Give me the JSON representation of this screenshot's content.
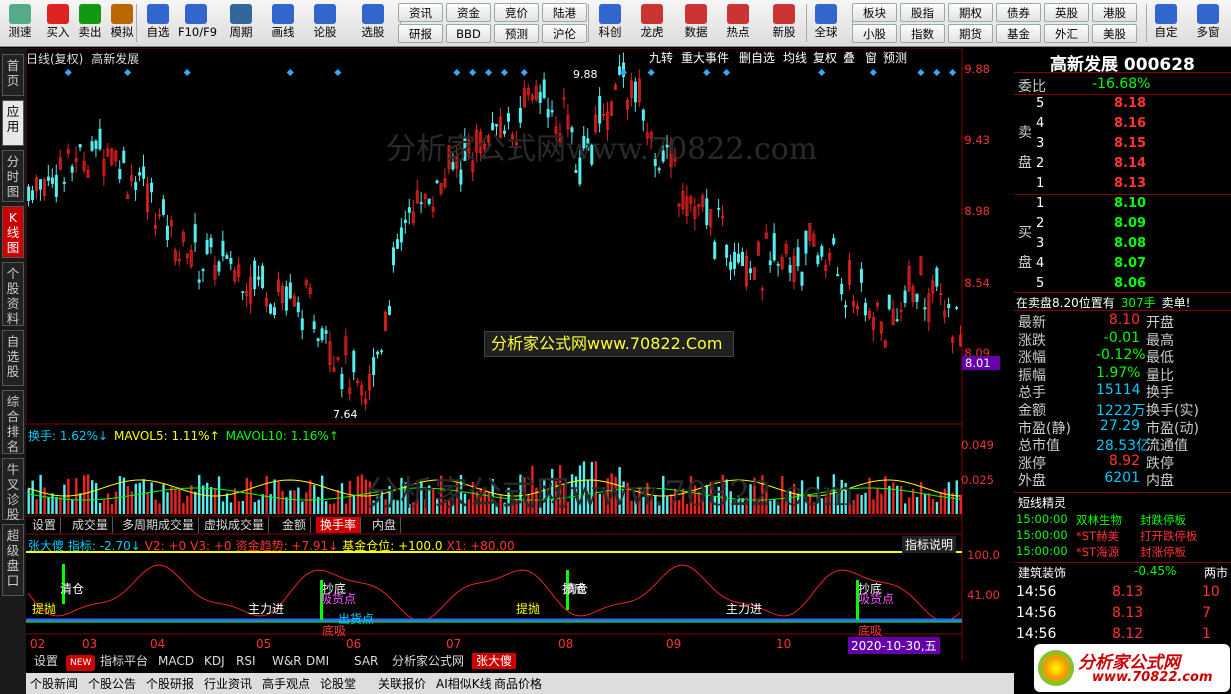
{
  "toolbar": {
    "items": [
      {
        "label": "测速",
        "color": "#5a8"
      },
      {
        "label": "买入",
        "color": "#d22"
      },
      {
        "label": "卖出",
        "color": "#191"
      },
      {
        "label": "模拟",
        "color": "#b60"
      },
      {
        "label": "自选",
        "color": "#36c"
      },
      {
        "label": "F10/F9",
        "color": "#36c"
      },
      {
        "label": "周期",
        "color": "#369"
      },
      {
        "label": "画线",
        "color": "#36c"
      },
      {
        "label": "论股",
        "color": "#36c"
      },
      {
        "label": "选股",
        "color": "#36c"
      },
      {
        "label": "科创",
        "color": "#36c"
      },
      {
        "label": "龙虎",
        "color": "#c33"
      },
      {
        "label": "数据",
        "color": "#c33"
      },
      {
        "label": "热点",
        "color": "#c33"
      },
      {
        "label": "新股",
        "color": "#c33"
      },
      {
        "label": "全球",
        "color": "#36c"
      },
      {
        "label": "自定",
        "color": "#36c"
      },
      {
        "label": "多窗",
        "color": "#36c"
      }
    ],
    "menu_row1": [
      "资讯",
      "资金",
      "竞价",
      "陆港",
      "板块",
      "股指",
      "期权",
      "债券",
      "英股",
      "港股"
    ],
    "menu_row2": [
      "研报",
      "BBD",
      "预测",
      "沪伦",
      "小股",
      "指数",
      "期货",
      "基金",
      "外汇",
      "美股"
    ]
  },
  "left_tabs": [
    "首页",
    "应用",
    "分时图",
    "K线图",
    "个股资料",
    "自选股",
    "综合排名",
    "牛叉诊股",
    "超级盘口"
  ],
  "chart": {
    "header": "日线(复权)",
    "name": "高新发展",
    "buttons": [
      "九转",
      "重大事件",
      "删自选",
      "均线",
      "复权",
      "叠",
      "窗",
      "预测"
    ],
    "price_labels": [
      "9.88",
      "9.43",
      "8.98",
      "8.54",
      "8.09"
    ],
    "current_price": "8.01",
    "high_label": "9.88",
    "low_label": "7.64",
    "watermark": "分析家公式网www.70822.com",
    "watermark_box": "分析家公式网www.70822.Com",
    "vol_info": {
      "a": "换手: 1.62%↓",
      "b": "MAVOL5: 1.11%↑",
      "c": "MAVOL10: 1.16%↑"
    },
    "vol_labels": [
      "0.049",
      "0.025"
    ],
    "sub_tabs": [
      "设置",
      "成交量",
      "多周期成交量",
      "虚拟成交量",
      "金额",
      "换手率",
      "内盘"
    ],
    "ind_info": {
      "a": "张大傻 指标: -2.70↓",
      "b": "V2: +0",
      "c": "V3: +0",
      "d": "资金趋势: +7.91↓",
      "e": "基金仓位: +100.0",
      "f": "X1: +80.00"
    },
    "ind_help": "指标说明",
    "ind_labels": [
      "100.0",
      "41.00"
    ],
    "signals": [
      "清仓",
      "抄底",
      "主力进",
      "提抛",
      "吸货点",
      "出货点",
      "底吸",
      "抄底",
      "主力进",
      "清仓",
      "抄底",
      "提抛",
      "吸货点",
      "底吸"
    ],
    "months": [
      "02",
      "03",
      "04",
      "05",
      "06",
      "07",
      "08",
      "09",
      "10"
    ],
    "date_label": "2020-10-30,五"
  },
  "bottom": {
    "tabs1": [
      "设置",
      "NEW",
      "指标平台",
      "MACD",
      "KDJ",
      "RSI",
      "W&R",
      "DMI",
      "SAR",
      "分析家公式网",
      "张大傻"
    ],
    "tabs2": [
      "个股新闻",
      "个股公告",
      "个股研报",
      "行业资讯",
      "高手观点",
      "论股堂",
      "关联报价",
      "AI相似K线",
      "商品价格"
    ]
  },
  "right": {
    "title": "高新发展 000628",
    "weibi_label": "委比",
    "weibi": "-16.68%",
    "sell_label": "卖 盘",
    "buy_label": "买 盘",
    "sells": [
      {
        "n": "5",
        "p": "8.18"
      },
      {
        "n": "4",
        "p": "8.16"
      },
      {
        "n": "3",
        "p": "8.15"
      },
      {
        "n": "2",
        "p": "8.14"
      },
      {
        "n": "1",
        "p": "8.13"
      }
    ],
    "buys": [
      {
        "n": "1",
        "p": "8.10"
      },
      {
        "n": "2",
        "p": "8.09"
      },
      {
        "n": "3",
        "p": "8.08"
      },
      {
        "n": "4",
        "p": "8.07"
      },
      {
        "n": "5",
        "p": "8.06"
      }
    ],
    "notice": "在卖盘8.20位置有",
    "notice_val": "307手",
    "notice_tail": "卖单!",
    "stats": [
      {
        "l": "最新",
        "v": "8.10",
        "r": "开盘"
      },
      {
        "l": "涨跌",
        "v": "-0.01",
        "r": "最高"
      },
      {
        "l": "涨幅",
        "v": "-0.12%",
        "r": "最低"
      },
      {
        "l": "振幅",
        "v": "1.97%",
        "r": "量比"
      },
      {
        "l": "总手",
        "v": "15114",
        "r": "换手"
      },
      {
        "l": "金额",
        "v": "1222万",
        "r": "换手(实)"
      },
      {
        "l": "市盈(静)",
        "v": "27.29",
        "r": "市盈(动)"
      },
      {
        "l": "总市值",
        "v": "28.53亿",
        "r": "流通值"
      },
      {
        "l": "涨停",
        "v": "8.92",
        "r": "跌停"
      },
      {
        "l": "外盘",
        "v": "6201",
        "r": "内盘"
      }
    ],
    "spirit_title": "短线精灵",
    "spirits": [
      {
        "t": "15:00:00",
        "n": "双林生物",
        "e": "封跌停板"
      },
      {
        "t": "15:00:00",
        "n": "*ST赫美",
        "e": "打开跌停板"
      },
      {
        "t": "15:00:00",
        "n": "*ST海源",
        "e": "封涨停板"
      }
    ],
    "sector": "建筑装饰",
    "sector_chg": "-0.45%",
    "sector_right": "两市",
    "ticks": [
      {
        "t": "14:56",
        "p": "8.13",
        "v": "10"
      },
      {
        "t": "14:56",
        "p": "8.13",
        "v": "7"
      },
      {
        "t": "14:56",
        "p": "8.12",
        "v": "1"
      }
    ],
    "logo": "分析家公式网",
    "logo_url": "www.70822.com"
  }
}
